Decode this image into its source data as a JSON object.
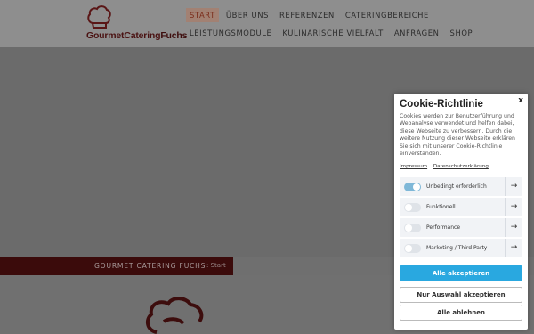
{
  "header": {
    "logo_text_a": "GourmetCatering",
    "logo_text_b": "Fuchs",
    "nav_row1": [
      {
        "label": "START",
        "active": true
      },
      {
        "label": "ÜBER UNS"
      },
      {
        "label": "REFERENZEN"
      },
      {
        "label": "CATERINGBEREICHE"
      }
    ],
    "nav_row2": [
      {
        "label": "LEISTUNGSMODULE"
      },
      {
        "label": "KULINARISCHE VIELFALT"
      },
      {
        "label": "ANFRAGEN"
      },
      {
        "label": "SHOP"
      }
    ]
  },
  "breadcrumb": {
    "title": "GOURMET CATERING FUCHS",
    "separator": ":",
    "current": "Start"
  },
  "cookie": {
    "title": "Cookie-Richtlinie",
    "close": "x",
    "text": "Cookies werden zur Benutzerführung und Webanalyse verwendet und helfen dabei, diese Webseite zu verbessern. Durch die weitere Nutzung dieser Webseite erklären Sie sich mit unserer Cookie-Richtlinie einverstanden.",
    "links": [
      "Impressum",
      "Datenschutzerklärung"
    ],
    "options": [
      {
        "label": "Unbedingt erforderlich",
        "on": true
      },
      {
        "label": "Funktionell",
        "on": false
      },
      {
        "label": "Performance",
        "on": false
      },
      {
        "label": "Marketing / Third Party",
        "on": false
      }
    ],
    "accept_all": "Alle akzeptieren",
    "accept_selection": "Nur Auswahl akzeptieren",
    "reject_all": "Alle ablehnen"
  },
  "colors": {
    "brand_dark_red": "#3b0b0b",
    "accent_blue": "#29a8e0"
  }
}
